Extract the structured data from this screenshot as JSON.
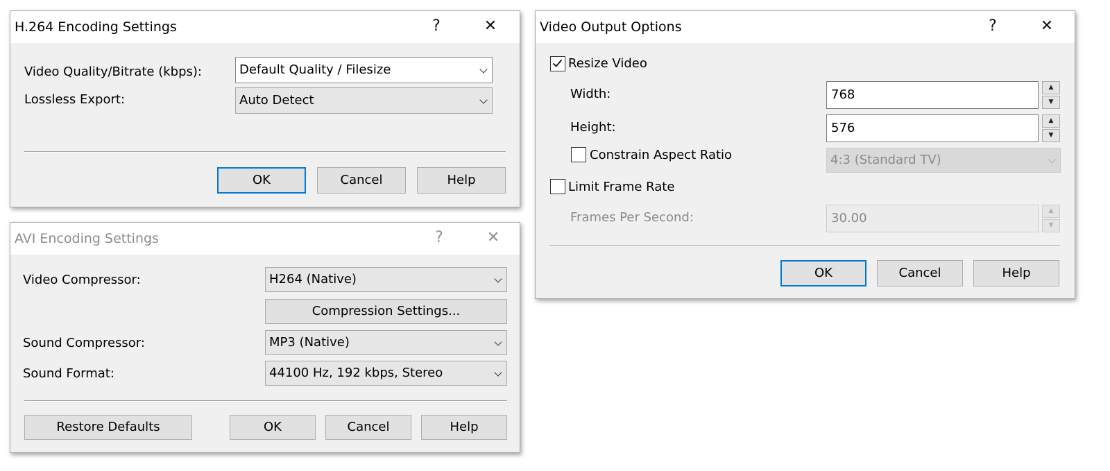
{
  "h264": {
    "title": "H.264 Encoding Settings",
    "help_glyph": "?",
    "close_glyph": "✕",
    "quality_label": "Video Quality/Bitrate (kbps):",
    "quality_value": "Default Quality / Filesize",
    "lossless_label": "Lossless Export:",
    "lossless_value": "Auto Detect",
    "ok": "OK",
    "cancel": "Cancel",
    "help": "Help"
  },
  "avi": {
    "title": "AVI Encoding Settings",
    "help_glyph": "?",
    "close_glyph": "✕",
    "video_compressor_label": "Video Compressor:",
    "video_compressor_value": "H264 (Native)",
    "compression_settings": "Compression Settings...",
    "sound_compressor_label": "Sound Compressor:",
    "sound_compressor_value": "MP3 (Native)",
    "sound_format_label": "Sound Format:",
    "sound_format_value": "44100 Hz, 192 kbps, Stereo",
    "restore_defaults": "Restore Defaults",
    "ok": "OK",
    "cancel": "Cancel",
    "help": "Help"
  },
  "video_output": {
    "title": "Video Output Options",
    "help_glyph": "?",
    "close_glyph": "✕",
    "resize_label": "Resize Video",
    "resize_checked": true,
    "width_label": "Width:",
    "width_value": "768",
    "height_label": "Height:",
    "height_value": "576",
    "constrain_label": "Constrain Aspect Ratio",
    "constrain_checked": false,
    "aspect_value": "4:3 (Standard TV)",
    "limit_label": "Limit Frame Rate",
    "limit_checked": false,
    "fps_label": "Frames Per Second:",
    "fps_value": "30.00",
    "ok": "OK",
    "cancel": "Cancel",
    "help": "Help"
  },
  "colors": {
    "dialog_bg": "#f0f0f0",
    "accent": "#0078d7",
    "disabled_text": "#8a8a8a"
  }
}
